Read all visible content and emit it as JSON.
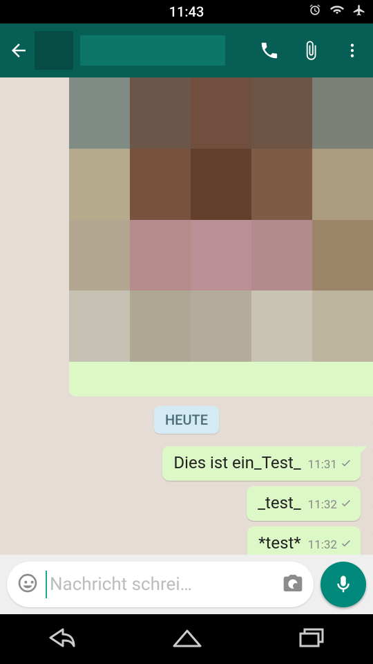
{
  "statusbar": {
    "time": "11:43"
  },
  "chat": {
    "date_chip": "HEUTE",
    "messages": [
      {
        "text": "Dies ist ein_Test_",
        "time": "11:31"
      },
      {
        "text": "_test_",
        "time": "11:32"
      },
      {
        "text": "*test*",
        "time": "11:32"
      }
    ]
  },
  "input": {
    "placeholder": "Nachricht schrei…"
  },
  "colors": {
    "appbar": "#075E54",
    "bubble_out": "#DCF8C6",
    "accent": "#00897B"
  }
}
